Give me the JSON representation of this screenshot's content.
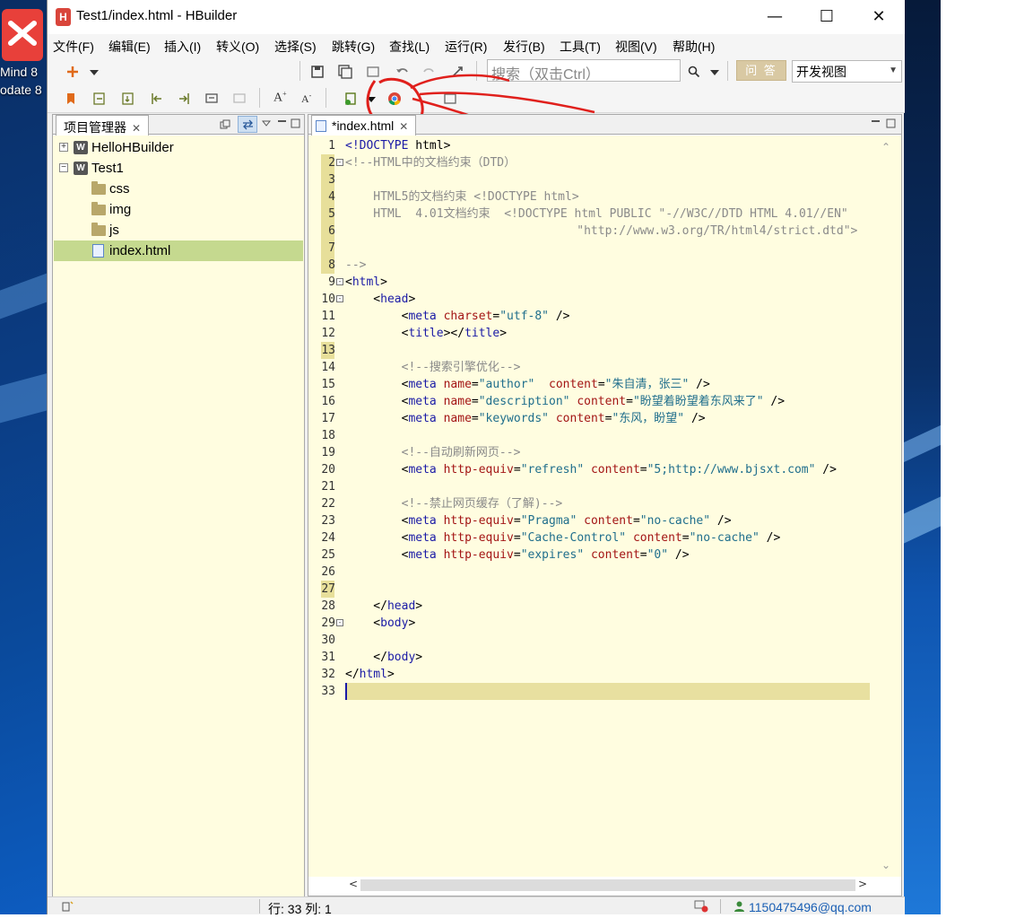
{
  "desktop": {
    "app_labels": [
      "Mind 8",
      "odate 8"
    ]
  },
  "window": {
    "title": "Test1/index.html  -  HBuilder",
    "app_icon_letter": "H",
    "controls": [
      "minimize",
      "maximize",
      "close"
    ]
  },
  "menubar": {
    "items": [
      "文件(F)",
      "编辑(E)",
      "插入(I)",
      "转义(O)",
      "选择(S)",
      "跳转(G)",
      "查找(L)",
      "运行(R)",
      "发行(B)",
      "工具(T)",
      "视图(V)",
      "帮助(H)"
    ]
  },
  "toolbar": {
    "search_placeholder": "搜索（双击Ctrl）",
    "ask_label": "问 答",
    "view_selected": "开发视图",
    "annotation_color": "#e0201c"
  },
  "project_explorer": {
    "tab_label": "项目管理器",
    "tree": [
      {
        "label": "HelloHBuilder",
        "type": "project",
        "expanded": false,
        "level": 0
      },
      {
        "label": "Test1",
        "type": "project",
        "expanded": true,
        "level": 0
      },
      {
        "label": "css",
        "type": "folder",
        "level": 1
      },
      {
        "label": "img",
        "type": "folder",
        "level": 1
      },
      {
        "label": "js",
        "type": "folder",
        "level": 1
      },
      {
        "label": "index.html",
        "type": "file",
        "level": 1,
        "selected": true
      }
    ]
  },
  "editor": {
    "tab_label": "*index.html",
    "current_line": 33,
    "lines": [
      "<!DOCTYPE html>",
      "<!--HTML中的文档约束（DTD）",
      "",
      "    HTML5的文档约束 <!DOCTYPE html>",
      "    HTML  4.01文档约束  <!DOCTYPE html PUBLIC \"-//W3C//DTD HTML 4.01//EN\"",
      "                                 \"http://www.w3.org/TR/html4/strict.dtd\">",
      "",
      "-->",
      "<html>",
      "    <head>",
      "        <meta charset=\"utf-8\" />",
      "        <title></title>",
      "",
      "        <!--搜索引擎优化-->",
      "        <meta name=\"author\"  content=\"朱自清，张三\" />",
      "        <meta name=\"description\" content=\"盼望着盼望着东风来了\" />",
      "        <meta name=\"keywords\" content=\"东风，盼望\" />",
      "",
      "        <!--自动刷新网页-->",
      "        <meta http-equiv=\"refresh\" content=\"5;http://www.bjsxt.com\" />",
      "",
      "        <!--禁止网页缓存（了解)-->",
      "        <meta http-equiv=\"Pragma\" content=\"no-cache\" />",
      "        <meta http-equiv=\"Cache-Control\" content=\"no-cache\" />",
      "        <meta http-equiv=\"expires\" content=\"0\" />",
      "",
      "",
      "    </head>",
      "    <body>",
      "",
      "    </body>",
      "</html>",
      ""
    ]
  },
  "statusbar": {
    "position": "行: 33 列: 1",
    "user": "1150475496@qq.com"
  }
}
